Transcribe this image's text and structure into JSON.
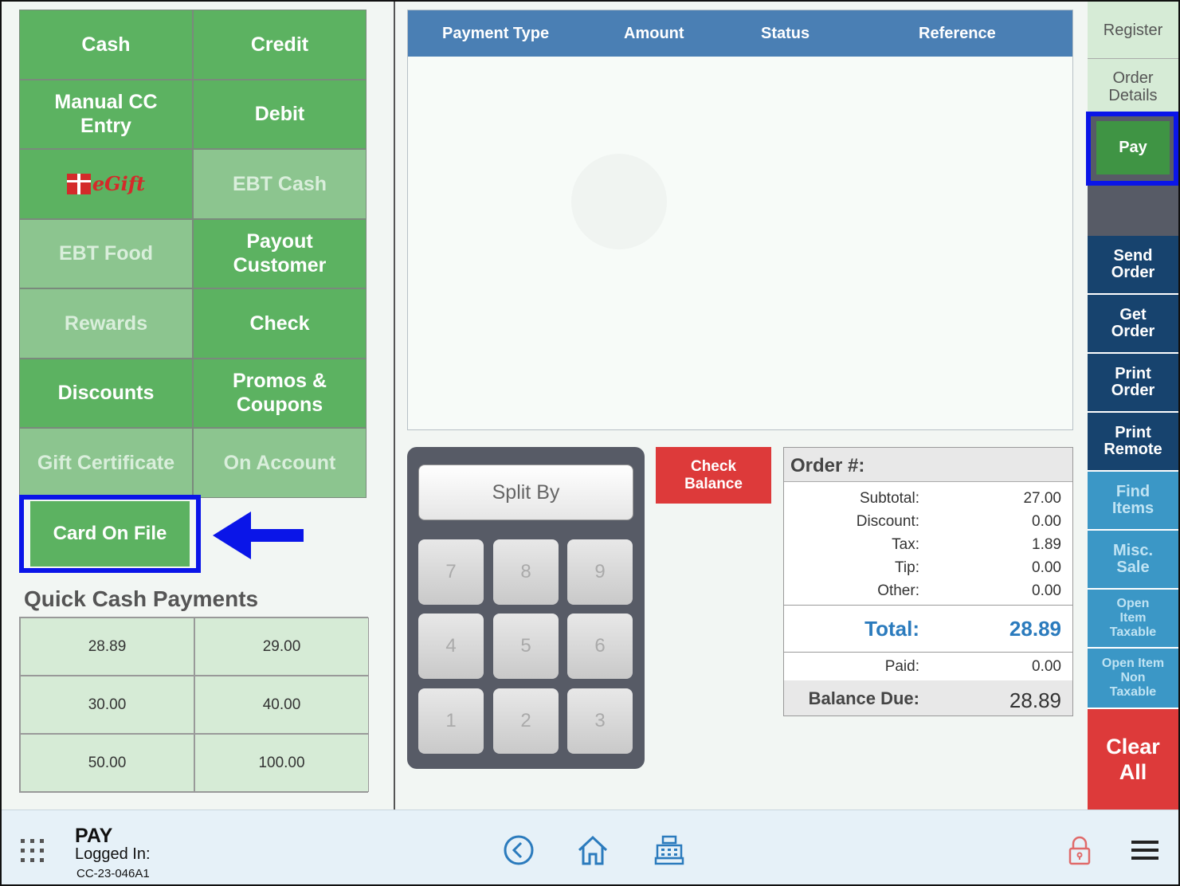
{
  "payment_types": [
    {
      "label": "Cash",
      "enabled": true
    },
    {
      "label": "Credit",
      "enabled": true
    },
    {
      "label": "Manual CC Entry",
      "enabled": true
    },
    {
      "label": "Debit",
      "enabled": true
    },
    {
      "label": "eGift",
      "enabled": true
    },
    {
      "label": "EBT Cash",
      "enabled": false
    },
    {
      "label": "EBT Food",
      "enabled": false
    },
    {
      "label": "Payout Customer",
      "enabled": true
    },
    {
      "label": "Rewards",
      "enabled": false
    },
    {
      "label": "Check",
      "enabled": true
    },
    {
      "label": "Discounts",
      "enabled": true
    },
    {
      "label": "Promos & Coupons",
      "enabled": true
    },
    {
      "label": "Gift Certificate",
      "enabled": false
    },
    {
      "label": "On Account",
      "enabled": false
    }
  ],
  "card_on_file": "Card On File",
  "quick_cash": {
    "title": "Quick Cash Payments",
    "amounts": [
      "28.89",
      "29.00",
      "30.00",
      "40.00",
      "50.00",
      "100.00"
    ]
  },
  "payments_table": {
    "columns": [
      "Payment Type",
      "Amount",
      "Status",
      "Reference"
    ]
  },
  "keypad": {
    "split_label": "Split By",
    "keys": [
      "7",
      "8",
      "9",
      "4",
      "5",
      "6",
      "1",
      "2",
      "3"
    ]
  },
  "check_balance": "Check Balance",
  "order": {
    "title": "Order #:",
    "subtotal_label": "Subtotal:",
    "subtotal": "27.00",
    "discount_label": "Discount:",
    "discount": "0.00",
    "tax_label": "Tax:",
    "tax": "1.89",
    "tip_label": "Tip:",
    "tip": "0.00",
    "other_label": "Other:",
    "other": "0.00",
    "total_label": "Total:",
    "total": "28.89",
    "paid_label": "Paid:",
    "paid": "0.00",
    "balance_label": "Balance Due:",
    "balance": "28.89"
  },
  "sidebar": {
    "register": "Register",
    "order_details": "Order Details",
    "pay": "Pay",
    "send_order": "Send Order",
    "get_order": "Get Order",
    "print_order": "Print Order",
    "print_remote": "Print Remote",
    "find_items": "Find Items",
    "misc_sale": "Misc. Sale",
    "open_item_taxable": "Open Item Taxable",
    "open_item_non_taxable": "Open Item Non Taxable",
    "clear_all": "Clear All"
  },
  "bottom_bar": {
    "screen_title": "PAY",
    "logged_in_label": "Logged In:",
    "terminal_id": "CC-23-046A1"
  },
  "colors": {
    "green": "#5cb261",
    "green_disabled": "#8cc58f",
    "header_blue": "#4a7fb4",
    "navy": "#17436e",
    "teal": "#3b97c6",
    "red": "#dd3a3a",
    "highlight": "#0a15e8"
  }
}
